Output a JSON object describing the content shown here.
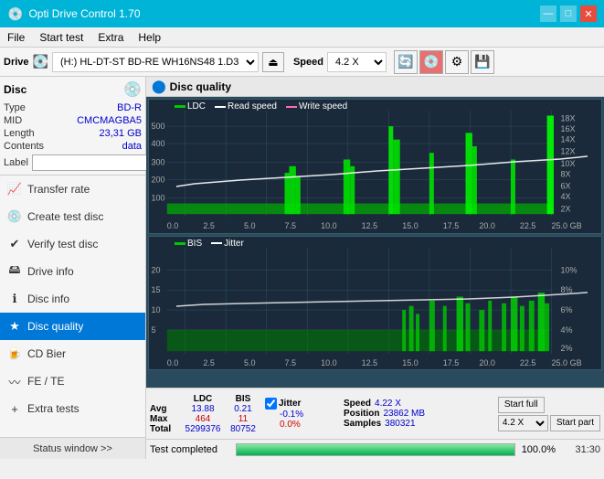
{
  "titleBar": {
    "title": "Opti Drive Control 1.70",
    "minimize": "—",
    "maximize": "□",
    "close": "✕"
  },
  "menuBar": {
    "items": [
      "File",
      "Start test",
      "Extra",
      "Help"
    ]
  },
  "driveBar": {
    "driveLabel": "Drive",
    "driveValue": "(H:)  HL-DT-ST BD-RE  WH16NS48 1.D3",
    "speedLabel": "Speed",
    "speedValue": "4.2 X"
  },
  "disc": {
    "title": "Disc",
    "typeLabel": "Type",
    "typeValue": "BD-R",
    "midLabel": "MID",
    "midValue": "CMCMAGBA5",
    "lengthLabel": "Length",
    "lengthValue": "23,31 GB",
    "contentsLabel": "Contents",
    "contentsValue": "data",
    "labelLabel": "Label"
  },
  "nav": {
    "items": [
      {
        "id": "transfer-rate",
        "label": "Transfer rate",
        "icon": "📈"
      },
      {
        "id": "create-test-disc",
        "label": "Create test disc",
        "icon": "💿"
      },
      {
        "id": "verify-test-disc",
        "label": "Verify test disc",
        "icon": "✔"
      },
      {
        "id": "drive-info",
        "label": "Drive info",
        "icon": "🖴"
      },
      {
        "id": "disc-info",
        "label": "Disc info",
        "icon": "ℹ"
      },
      {
        "id": "disc-quality",
        "label": "Disc quality",
        "icon": "★",
        "active": true
      },
      {
        "id": "cd-bier",
        "label": "CD Bier",
        "icon": "🍺"
      },
      {
        "id": "fe-te",
        "label": "FE / TE",
        "icon": "〰"
      },
      {
        "id": "extra-tests",
        "label": "Extra tests",
        "icon": "+"
      }
    ],
    "statusWindow": "Status window >>"
  },
  "discQuality": {
    "title": "Disc quality",
    "legend": {
      "ldc": "LDC",
      "readSpeed": "Read speed",
      "writeSpeed": "Write speed",
      "bis": "BIS",
      "jitter": "Jitter"
    }
  },
  "chart1": {
    "yMax": 500,
    "yLabels": [
      "18X",
      "16X",
      "14X",
      "12X",
      "10X",
      "8X",
      "6X",
      "4X",
      "2X"
    ],
    "yLeftLabels": [
      "500",
      "400",
      "300",
      "200",
      "100"
    ],
    "xLabels": [
      "0.0",
      "2.5",
      "5.0",
      "7.5",
      "10.0",
      "12.5",
      "15.0",
      "17.5",
      "20.0",
      "22.5",
      "25.0 GB"
    ]
  },
  "chart2": {
    "yMax": 20,
    "yLabels": [
      "10%",
      "8%",
      "6%",
      "4%",
      "2%"
    ],
    "yLeftLabels": [
      "20",
      "15",
      "10",
      "5"
    ],
    "xLabels": [
      "0.0",
      "2.5",
      "5.0",
      "7.5",
      "10.0",
      "12.5",
      "15.0",
      "17.5",
      "20.0",
      "22.5",
      "25.0 GB"
    ]
  },
  "stats": {
    "ldcLabel": "LDC",
    "bisLabel": "BIS",
    "jitterLabel": "Jitter",
    "speedLabel": "Speed",
    "avgRow": {
      "label": "Avg",
      "ldc": "13.88",
      "bis": "0.21",
      "jitter": "-0.1%"
    },
    "maxRow": {
      "label": "Max",
      "ldc": "464",
      "bis": "11",
      "jitter": "0.0%"
    },
    "totalRow": {
      "label": "Total",
      "ldc": "5299376",
      "bis": "80752"
    },
    "speedValue": "4.22 X",
    "positionLabel": "Position",
    "positionValue": "23862 MB",
    "samplesLabel": "Samples",
    "samplesValue": "380321",
    "startFull": "Start full",
    "startPart": "Start part",
    "speedDropdown": "4.2 X",
    "jitterChecked": true
  },
  "progressBar": {
    "statusText": "Test completed",
    "percent": "100.0%",
    "time": "31:30"
  },
  "colors": {
    "accent": "#00b4d8",
    "ldcFill": "#00c800",
    "readSpeed": "#ffffff",
    "writeSpeed": "#ff69b4",
    "bis": "#00c800",
    "jitterLine": "#ffff00",
    "activeNav": "#0078d7"
  }
}
